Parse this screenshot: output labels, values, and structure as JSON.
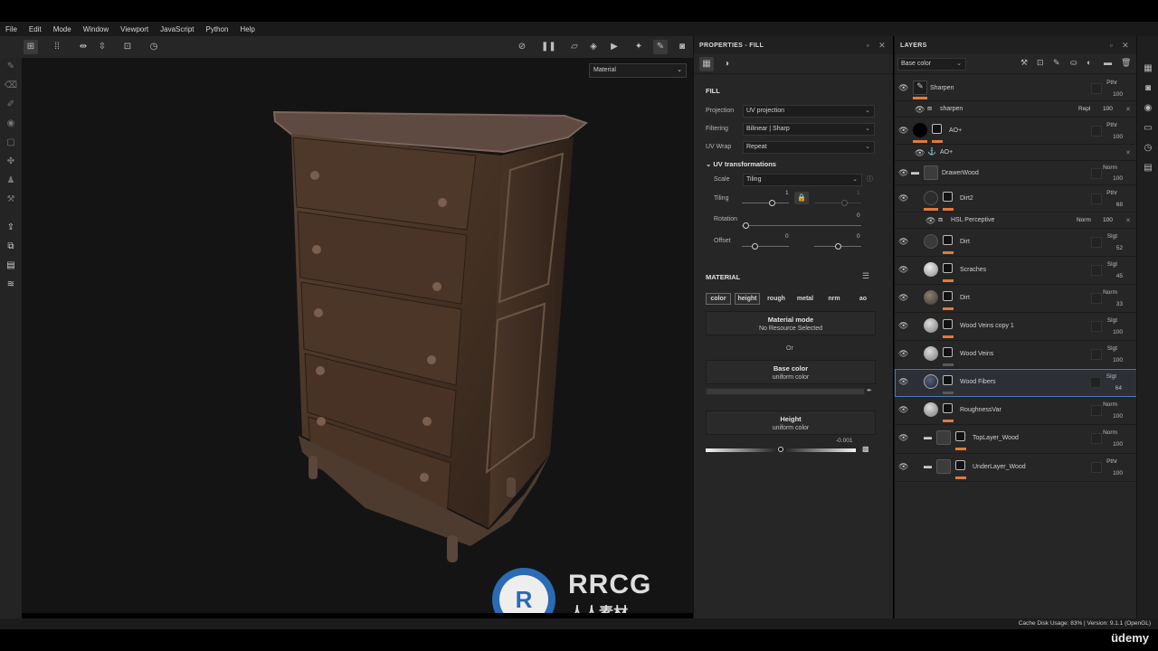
{
  "menu": [
    "File",
    "Edit",
    "Mode",
    "Window",
    "Viewport",
    "JavaScript",
    "Python",
    "Help"
  ],
  "viewport": {
    "mode_select": "Material"
  },
  "properties": {
    "title": "PROPERTIES - FILL",
    "fill_heading": "FILL",
    "projection_label": "Projection",
    "projection_value": "UV projection",
    "filtering_label": "Filtering",
    "filtering_value": "Bilinear | Sharp",
    "uvwrap_label": "UV Wrap",
    "uvwrap_value": "Repeat",
    "uvt_heading": "UV transformations",
    "scale_label": "Scale",
    "scale_value": "Tiling",
    "tiling_label": "Tiling",
    "tiling_value": "1",
    "tiling_value2": "1",
    "rotation_label": "Rotation",
    "rotation_value": "0",
    "offset_label": "Offset",
    "offset_x": "0",
    "offset_y": "0",
    "material_heading": "MATERIAL",
    "channels": [
      "color",
      "height",
      "rough",
      "metal",
      "nrm",
      "ao"
    ],
    "mat_mode_title": "Material mode",
    "mat_mode_sub": "No Resource Selected",
    "or_text": "Or",
    "base_color_title": "Base color",
    "base_color_sub": "uniform color",
    "height_title": "Height",
    "height_sub": "uniform color",
    "height_value": "-0.001"
  },
  "layers": {
    "title": "LAYERS",
    "channel_select": "Base color",
    "items": [
      {
        "name": "Sharpen",
        "blend": "Pthr",
        "opacity": "100"
      },
      {
        "name": "sharpen",
        "blend": "Repl",
        "opacity": "100"
      },
      {
        "name": "AO+",
        "blend": "Pthr",
        "opacity": "100"
      },
      {
        "name": "AO+",
        "blend": "",
        "opacity": ""
      },
      {
        "name": "DrawerWood",
        "blend": "Norm",
        "opacity": "100"
      },
      {
        "name": "Dirt2",
        "blend": "Pthr",
        "opacity": "68"
      },
      {
        "name": "HSL Perceptive",
        "blend": "Norm",
        "opacity": "100"
      },
      {
        "name": "Dirt",
        "blend": "Slgt",
        "opacity": "52"
      },
      {
        "name": "Scraches",
        "blend": "Slgt",
        "opacity": "45"
      },
      {
        "name": "Dirt",
        "blend": "Norm",
        "opacity": "33"
      },
      {
        "name": "Wood Veins copy 1",
        "blend": "Slgt",
        "opacity": "100"
      },
      {
        "name": "Wood Veins",
        "blend": "Slgt",
        "opacity": "100"
      },
      {
        "name": "Wood Fibers",
        "blend": "Slgt",
        "opacity": "64"
      },
      {
        "name": "RoughnessVar",
        "blend": "Norm",
        "opacity": "100"
      },
      {
        "name": "TopLayer_Wood",
        "blend": "Norm",
        "opacity": "100"
      },
      {
        "name": "UnderLayer_Wood",
        "blend": "Pthr",
        "opacity": "100"
      }
    ]
  },
  "status": {
    "text": "Cache Disk Usage:  83% | Version: 9.1.1 (OpenGL)"
  },
  "watermark": {
    "brand": "RRCG",
    "sub": "人人素材"
  },
  "udemy": "üdemy",
  "colors": {
    "accent_orange": "#e07a3a",
    "selection_blue": "#4f79b4",
    "wood": "#4a3526"
  }
}
